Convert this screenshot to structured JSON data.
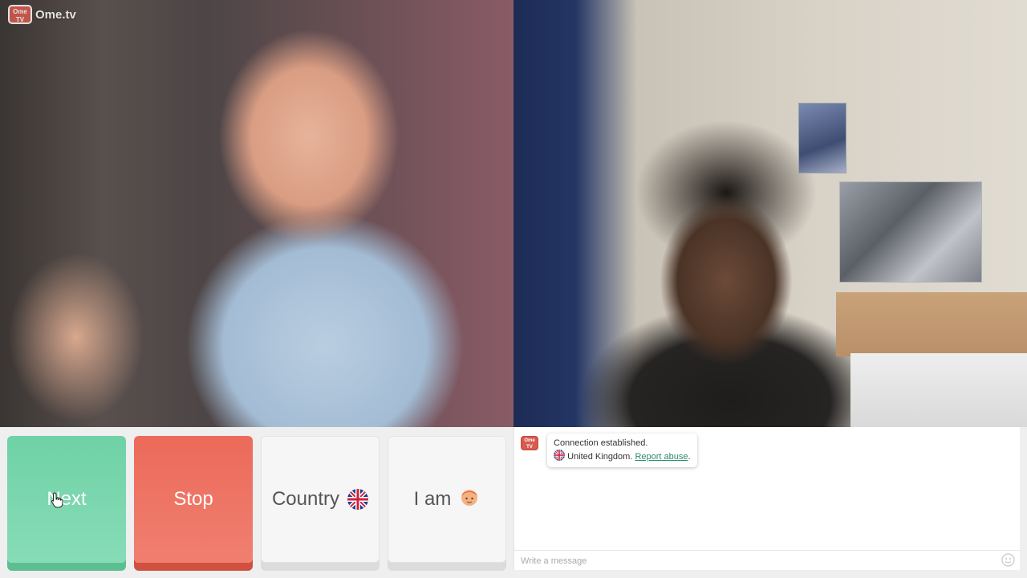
{
  "app": {
    "logo_badge": "Ome TV",
    "logo_text": "Ome.tv"
  },
  "controls": {
    "next_label": "Next",
    "stop_label": "Stop",
    "country_label": "Country",
    "iam_label": "I am",
    "country_flag": "united-kingdom-flag-icon",
    "iam_icon": "boy-face-icon"
  },
  "chat": {
    "system_logo": "Ome TV",
    "messages": [
      {
        "line1": "Connection established.",
        "country": "United Kingdom.",
        "link": "Report abuse",
        "suffix": "."
      }
    ],
    "input_placeholder": "Write a message"
  },
  "colors": {
    "next": "#6fd1a6",
    "stop": "#ec6a5a",
    "neutral": "#f6f6f6",
    "link": "#2a8c6a",
    "brand": "#d95a4e"
  }
}
